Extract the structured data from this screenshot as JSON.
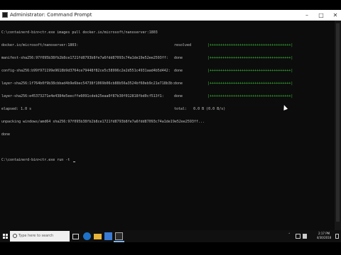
{
  "window": {
    "title": "Administrator: Command Prompt",
    "minimize_glyph": "–",
    "maximize_glyph": "□",
    "close_glyph": "✕"
  },
  "terminal": {
    "lines": [
      {
        "text": "C:\\containerd-bin>ctr.exe images pull docker.io/microsoft/nanoserver:1803"
      },
      {
        "text": "docker.io/microsoft/nanoserver:1803:",
        "status": "resolved",
        "bar": "|++++++++++++++++++++++++++++++++++++++|"
      },
      {
        "text": "manifest-sha256:97f095b38fb2b8ce1721fd8793b8fe7a6fdd87093c74a1de19e52ee2593ff:",
        "status": "done",
        "bar": "|++++++++++++++++++++++++++++++++++++++|"
      },
      {
        "text": "config-sha256:b99f971199e9618b9d3764ce79448f82ce5c58996c2e2d551c4931aad4b5d442:",
        "status": "done",
        "bar": "|++++++++++++++++++++++++++++++++++++++|"
      },
      {
        "text": "layer-sha256:1f764b0f9b38cbbad4b9e6bec54738f1069b06cb88b56a3524bf60eb9c21e718b3b:",
        "status": "done",
        "bar": "|++++++++++++++++++++++++++++++++++++++|"
      },
      {
        "text": "layer-sha256:e45373271e4e4384e5eecffe6091cdeb25eaa0f87b30f012818fbd0cf513f1:",
        "status": "done",
        "bar": "|++++++++++++++++++++++++++++++++++++++|"
      },
      {
        "text": "elapsed: 1.0 s",
        "status": "total:   0.0 B (0.0 B/s)"
      },
      {
        "text": "unpacking windows/amd64 sha256:97f095b38fb2b8ce1721fd8793b8fe7a6fdd87093c74a1de19e52ee2593ff..."
      },
      {
        "text": "done"
      },
      {
        "text": ""
      },
      {
        "text": "C:\\containerd-bin>ctr.exe run -t ",
        "cursor": true
      }
    ]
  },
  "taskbar": {
    "search_placeholder": "Type here to search",
    "clock_time": "2:17 PM",
    "clock_date": "4/30/2018",
    "tray_arrow": "˄"
  }
}
